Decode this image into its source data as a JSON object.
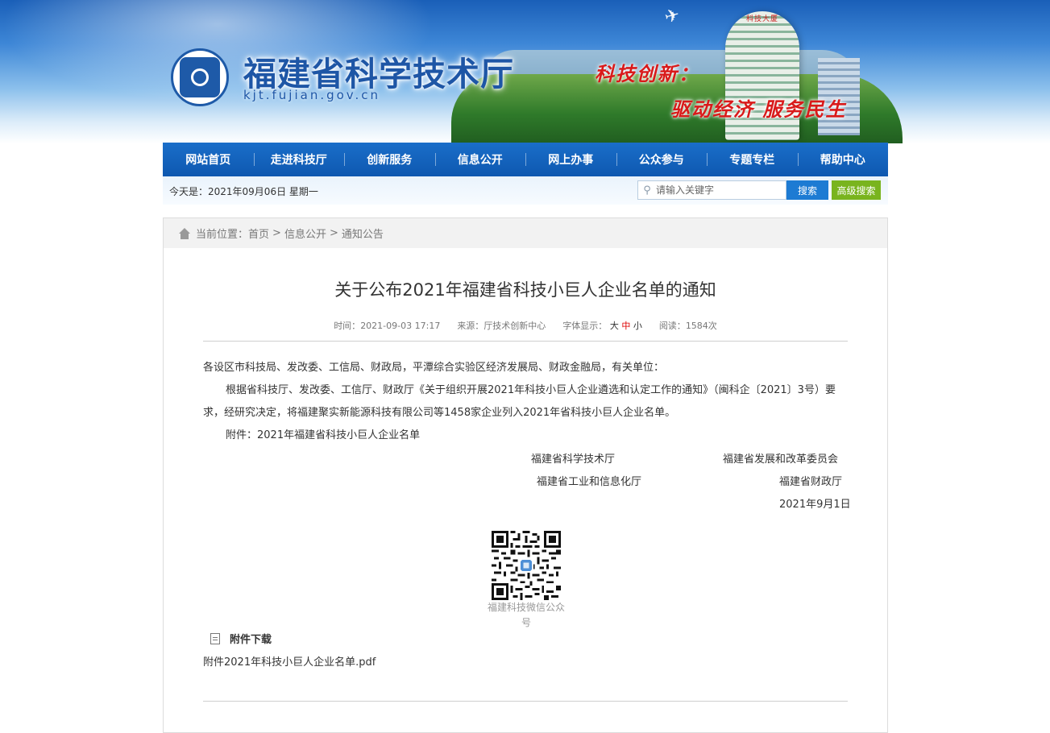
{
  "header": {
    "site_title": "福建省科学技术厅",
    "site_domain": "kjt.fujian.gov.cn",
    "slogan_line1": "科技创新：",
    "slogan_line2": "驱动经济 服务民生",
    "tower_sign": "科技大厦"
  },
  "nav": {
    "items": [
      "网站首页",
      "走进科技厅",
      "创新服务",
      "信息公开",
      "网上办事",
      "公众参与",
      "专题专栏",
      "帮助中心"
    ]
  },
  "subbar": {
    "today": "今天是：2021年09月06日  星期一",
    "search_placeholder": "请输入关键字",
    "search_button": "搜索",
    "advanced_search_button": "高级搜索"
  },
  "breadcrumb": {
    "prefix": "当前位置：",
    "items": [
      "首页",
      "信息公开",
      "通知公告"
    ],
    "separator": ">"
  },
  "article": {
    "title": "关于公布2021年福建省科技小巨人企业名单的通知",
    "meta": {
      "time_label": "时间：",
      "time": "2021-09-03 17:17",
      "source_label": "来源：",
      "source": "厅技术创新中心",
      "font_label": "字体显示：",
      "font_large": "大",
      "font_medium": "中",
      "font_small": "小",
      "views_label": "阅读：",
      "views": "1584次"
    },
    "salutation": "各设区市科技局、发改委、工信局、财政局，平潭综合实验区经济发展局、财政金融局，有关单位：",
    "paragraph": "根据省科技厅、发改委、工信厅、财政厅《关于组织开展2021年科技小巨人企业遴选和认定工作的通知》（闽科企〔2021〕3号）要求，经研究决定，将福建聚实新能源科技有限公司等1458家企业列入2021年省科技小巨人企业名单。",
    "attachment_line": "附件：2021年福建省科技小巨人企业名单",
    "signatories": {
      "org1": "福建省科学技术厅",
      "org2": "福建省发展和改革委员会",
      "org3": "福建省工业和信息化厅",
      "org4": "福建省财政厅",
      "date": "2021年9月1日"
    },
    "qr_caption": "福建科技微信公众号",
    "attachments_heading": "附件下载",
    "attachment_file": "附件2021年科技小巨人企业名单.pdf"
  },
  "colors": {
    "nav_blue": "#0e58b0",
    "search_blue": "#1d7bd3",
    "advanced_green": "#79b41e",
    "slogan_red": "#d91a1a",
    "font_mid_red": "#dd0000"
  }
}
